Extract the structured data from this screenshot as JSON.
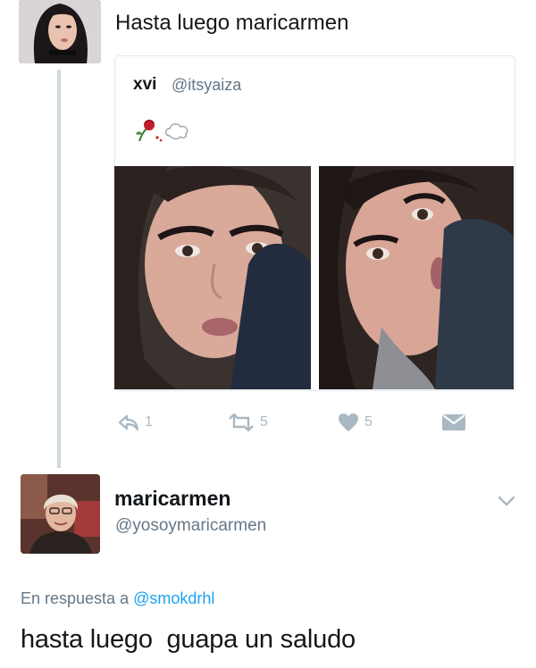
{
  "top_tweet": {
    "avatar_icon": "user-avatar-dark-hair-icon",
    "text": "Hasta luego maricarmen"
  },
  "quoted_tweet": {
    "name": "xvi",
    "handle": "@itsyaiza",
    "emoji_icons": [
      "wilted-rose-icon",
      "cloud-icon"
    ],
    "photos": [
      "photo-woman-selfie-1",
      "photo-woman-selfie-2"
    ],
    "actions": {
      "reply_count": "1",
      "retweet_count": "5",
      "like_count": "5",
      "icons": [
        "reply-icon",
        "retweet-icon",
        "heart-icon",
        "message-icon"
      ]
    }
  },
  "reply_tweet": {
    "avatar_icon": "user-avatar-older-woman-icon",
    "name": "maricarmen",
    "handle": "@yosoymaricarmen",
    "in_reply_prefix": "En respuesta a",
    "in_reply_mention": "@smokdrhl",
    "text": "hasta luego  guapa un saludo"
  },
  "colors": {
    "muted": "#657786",
    "link": "#1da1f2",
    "action_gray": "#aab8c2",
    "border": "#e1e8ed"
  }
}
